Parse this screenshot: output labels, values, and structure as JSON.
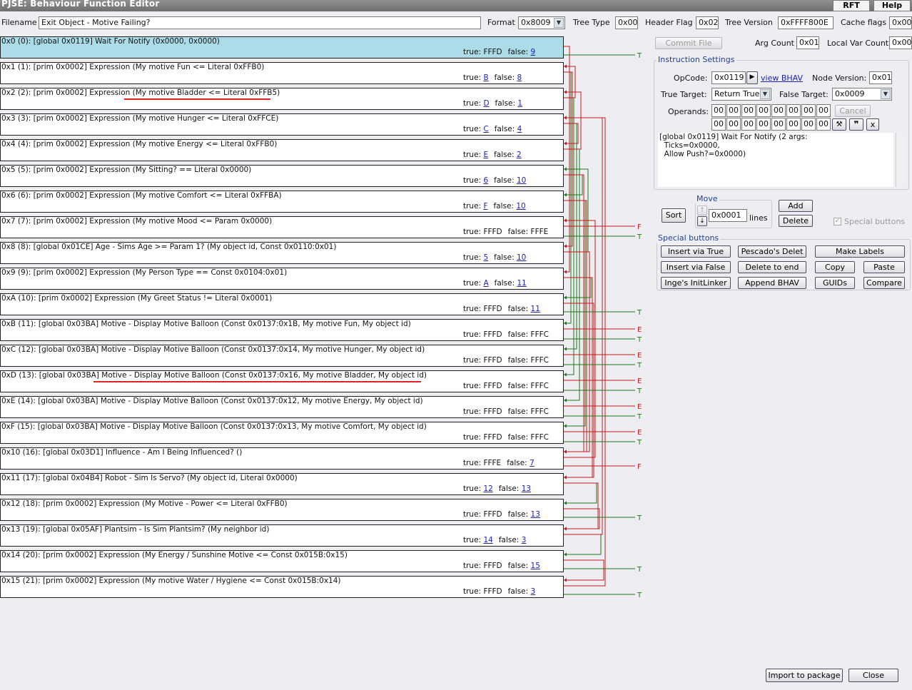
{
  "window": {
    "title": "PJSE: Behaviour Function Editor",
    "rft_label": "RFT",
    "help_label": "Help"
  },
  "header": {
    "filename_label": "Filename",
    "filename_value": "Exit Object - Motive Failing?",
    "format_label": "Format",
    "format_value": "0x8009",
    "treetype_label": "Tree Type",
    "treetype_value": "0x00",
    "headerflag_label": "Header Flag",
    "headerflag_value": "0x02",
    "treeversion_label": "Tree Version",
    "treeversion_value": "0xFFFF800E",
    "cacheflags_label": "Cache flags",
    "cacheflags_value": "0x00"
  },
  "nodes": [
    {
      "label": "0x0 (0): [global 0x0119] Wait For Notify (0x0000, 0x0000)",
      "true": "FFFD",
      "false": "9",
      "true_link": false,
      "false_link": true
    },
    {
      "label": "0x1 (1): [prim 0x0002] Expression (My motive Fun <= Literal 0xFFB0)",
      "true": "B",
      "false": "8",
      "true_link": true,
      "false_link": true
    },
    {
      "label": "0x2 (2): [prim 0x0002] Expression (My motive Bladder <= Literal 0xFFB5)",
      "true": "D",
      "false": "1",
      "true_link": true,
      "false_link": true
    },
    {
      "label": "0x3 (3): [prim 0x0002] Expression (My motive Hunger <= Literal 0xFFCE)",
      "true": "C",
      "false": "4",
      "true_link": true,
      "false_link": true
    },
    {
      "label": "0x4 (4): [prim 0x0002] Expression (My motive Energy <= Literal 0xFFB0)",
      "true": "E",
      "false": "2",
      "true_link": true,
      "false_link": true
    },
    {
      "label": "0x5 (5): [prim 0x0002] Expression (My Sitting? == Literal 0x0000)",
      "true": "6",
      "false": "10",
      "true_link": true,
      "false_link": true
    },
    {
      "label": "0x6 (6): [prim 0x0002] Expression (My motive Comfort <= Literal 0xFFBA)",
      "true": "F",
      "false": "10",
      "true_link": true,
      "false_link": true
    },
    {
      "label": "0x7 (7): [prim 0x0002] Expression (My motive Mood <= Param 0x0000)",
      "true": "FFFD",
      "false": "FFFE",
      "true_link": false,
      "false_link": false
    },
    {
      "label": "0x8 (8): [global 0x01CE] Age - Sims Age >= Param 1? (My object id, Const 0x0110:0x01)",
      "true": "5",
      "false": "10",
      "true_link": true,
      "false_link": true
    },
    {
      "label": "0x9 (9): [prim 0x0002] Expression (My Person Type == Const 0x0104:0x01)",
      "true": "A",
      "false": "11",
      "true_link": true,
      "false_link": true
    },
    {
      "label": "0xA (10): [prim 0x0002] Expression (My Greet Status != Literal 0x0001)",
      "true": "FFFD",
      "false": "11",
      "true_link": false,
      "false_link": true
    },
    {
      "label": "0xB (11): [global 0x03BA] Motive - Display Motive Balloon (Const 0x0137:0x1B, My motive Fun, My object id)",
      "true": "FFFD",
      "false": "FFFC",
      "true_link": false,
      "false_link": false
    },
    {
      "label": "0xC (12): [global 0x03BA] Motive - Display Motive Balloon (Const 0x0137:0x14, My motive Hunger, My object id)",
      "true": "FFFD",
      "false": "FFFC",
      "true_link": false,
      "false_link": false
    },
    {
      "label": "0xD (13): [global 0x03BA] Motive - Display Motive Balloon (Const 0x0137:0x16, My motive Bladder, My object id)",
      "true": "FFFD",
      "false": "FFFC",
      "true_link": false,
      "false_link": false
    },
    {
      "label": "0xE (14): [global 0x03BA] Motive - Display Motive Balloon (Const 0x0137:0x12, My motive Energy, My object id)",
      "true": "FFFD",
      "false": "FFFC",
      "true_link": false,
      "false_link": false
    },
    {
      "label": "0xF (15): [global 0x03BA] Motive - Display Motive Balloon (Const 0x0137:0x13, My motive Comfort, My object id)",
      "true": "FFFD",
      "false": "FFFC",
      "true_link": false,
      "false_link": false
    },
    {
      "label": "0x10 (16): [global 0x03D1] Influence - Am I Being Influenced? ()",
      "true": "FFFE",
      "false": "7",
      "true_link": false,
      "false_link": true
    },
    {
      "label": "0x11 (17): [global 0x04B4] Robot - Sim Is Servo? (My object id, Literal 0x0000)",
      "true": "12",
      "false": "13",
      "true_link": true,
      "false_link": true
    },
    {
      "label": "0x12 (18): [prim 0x0002] Expression (My Motive - Power <= Literal 0xFFB0)",
      "true": "FFFD",
      "false": "13",
      "true_link": false,
      "false_link": true
    },
    {
      "label": "0x13 (19): [global 0x05AF] Plantsim - Is Sim Plantsim? (My neighbor id)",
      "true": "14",
      "false": "3",
      "true_link": true,
      "false_link": true
    },
    {
      "label": "0x14 (20): [prim 0x0002] Expression (My Energy / Sunshine Motive <= Const 0x015B:0x15)",
      "true": "FFFD",
      "false": "15",
      "true_link": false,
      "false_link": true
    },
    {
      "label": "0x15 (21): [prim 0x0002] Expression (My motive Water / Hygiene <= Const 0x015B:0x14)",
      "true": "FFFD",
      "false": "3",
      "true_link": false,
      "false_link": true
    }
  ],
  "node_words": {
    "true": "true:",
    "false": "false:"
  },
  "exit_marks": [
    "T",
    "",
    "",
    "",
    "",
    "",
    "",
    "F|T",
    "",
    "",
    "T",
    "E|T",
    "E|T",
    "E|T",
    "E|T",
    "E|T",
    "F",
    "",
    "T",
    "",
    "T",
    "T"
  ],
  "right_panel": {
    "commit_label": "Commit File",
    "argcount_label": "Arg Count",
    "argcount_value": "0x01",
    "localvar_label": "Local Var Count",
    "localvar_value": "0x00",
    "instruction_settings_title": "Instruction Settings",
    "opcode_label": "OpCode:",
    "opcode_value": "0x0119",
    "view_bhav_label": "view BHAV",
    "nodeversion_label": "Node Version:",
    "nodeversion_value": "0x01",
    "truetarget_label": "True Target:",
    "truetarget_value": "Return True",
    "falsetarget_label": "False Target:",
    "falsetarget_value": "0x0009",
    "operands_label": "Operands:",
    "operands_row1": [
      "00",
      "00",
      "00",
      "00",
      "00",
      "00",
      "00",
      "00"
    ],
    "operands_row2": [
      "00",
      "00",
      "00",
      "00",
      "00",
      "00",
      "00",
      "00"
    ],
    "cancel_label": "Cancel",
    "x_label": "x",
    "description": "[global 0x0119] Wait For Notify (2 args:\n  Ticks=0x0000,\n  Allow Push?=0x0000)",
    "sort_label": "Sort",
    "move_title": "Move",
    "move_value": "0x0001",
    "lines_label": "lines",
    "add_label": "Add",
    "delete_label": "Delete",
    "special_checkbox_label": "Special buttons",
    "special_title": "Special buttons",
    "special_buttons": [
      "Insert via True",
      "Pescado's Delet",
      "Make Labels",
      "Insert via False",
      "Delete to end",
      "Copy",
      "Paste",
      "Inge's InitLinker",
      "Append BHAV",
      "GUIDs",
      "Compare"
    ],
    "import_label": "Import to package",
    "close_label": "Close"
  },
  "colors": {
    "true_link": "#1a7a1a",
    "false_link": "#c41a1a",
    "highlight": "#e32222",
    "selected_row": "#acdce8"
  }
}
